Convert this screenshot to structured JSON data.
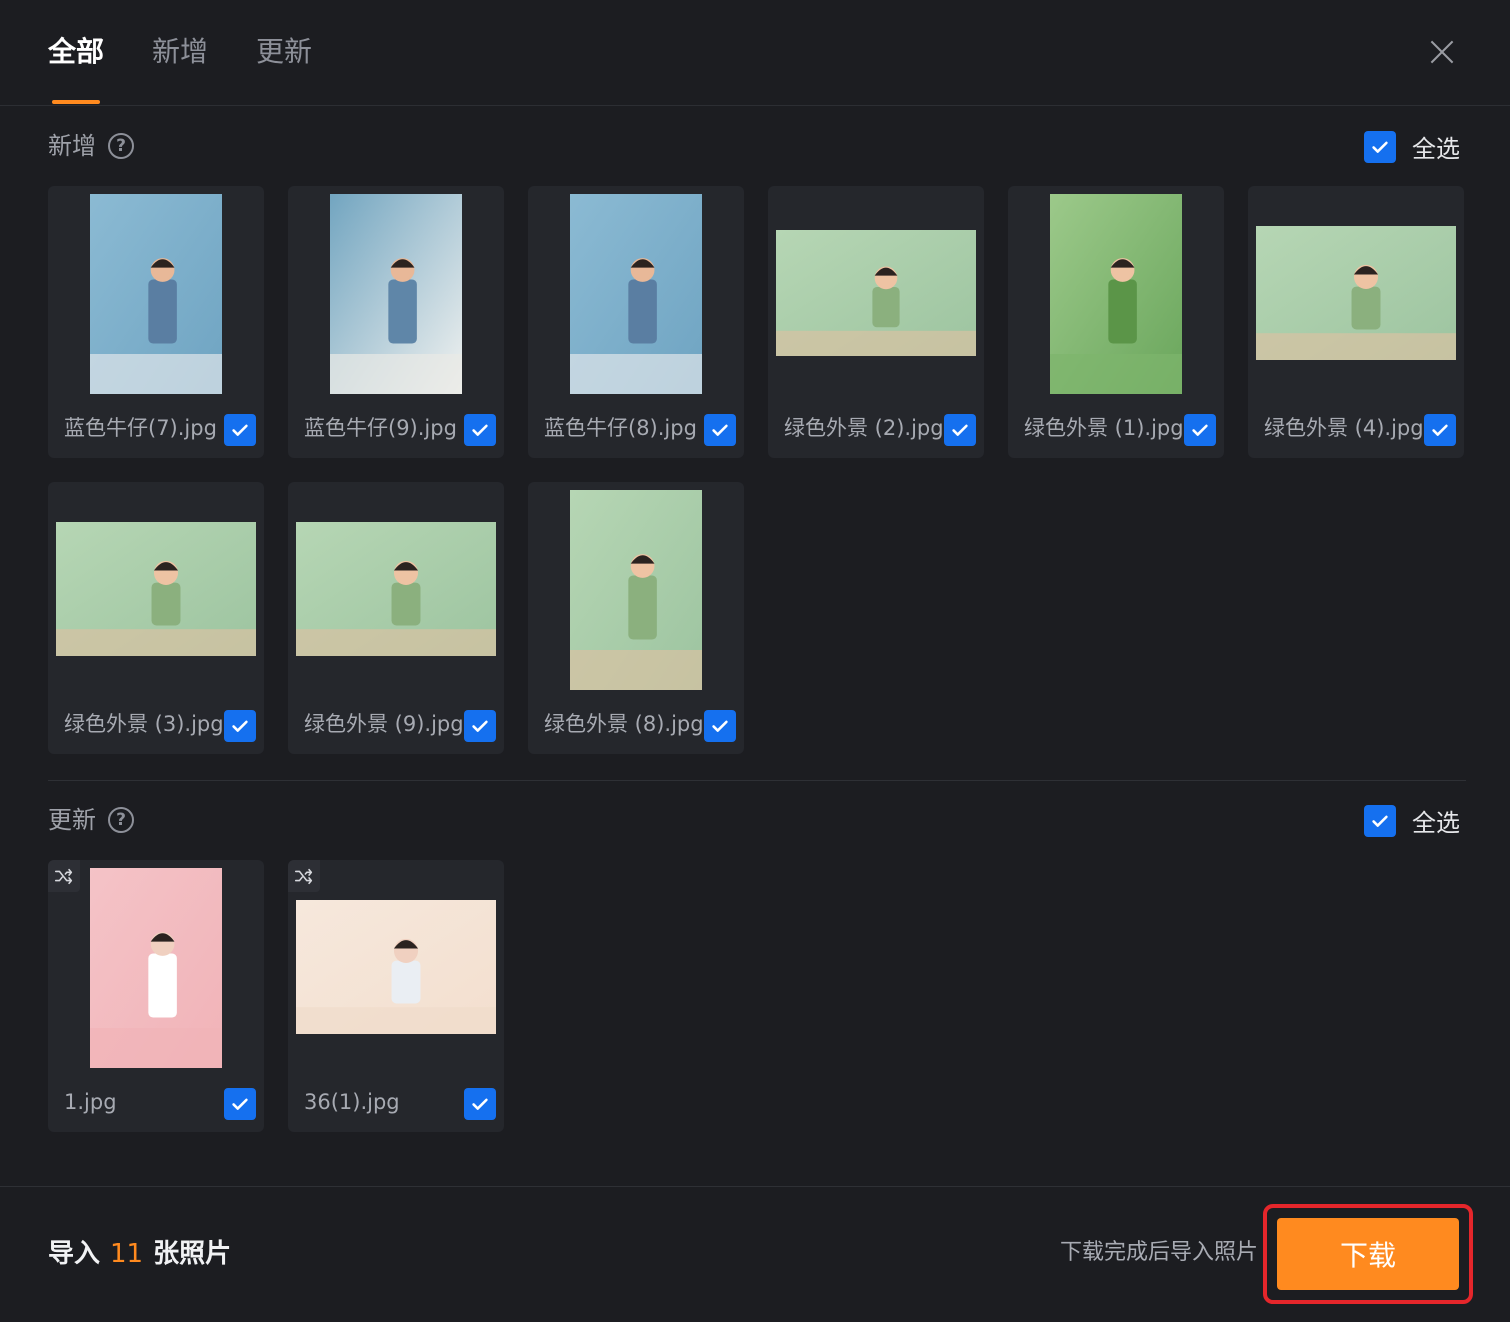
{
  "tabs": [
    {
      "label": "全部",
      "active": true
    },
    {
      "label": "新增",
      "active": false
    },
    {
      "label": "更新",
      "active": false
    }
  ],
  "sections": {
    "new": {
      "title": "新增",
      "select_all_label": "全选",
      "select_all_checked": true
    },
    "updated": {
      "title": "更新",
      "select_all_label": "全选",
      "select_all_checked": true
    }
  },
  "new_photos": [
    {
      "name": "蓝色牛仔(7).jpg",
      "checked": true,
      "theme": "blue"
    },
    {
      "name": "蓝色牛仔(9).jpg",
      "checked": true,
      "theme": "blue-light"
    },
    {
      "name": "蓝色牛仔(8).jpg",
      "checked": true,
      "theme": "blue"
    },
    {
      "name": "绿色外景 (2).jpg",
      "checked": true,
      "theme": "green"
    },
    {
      "name": "绿色外景 (1).jpg",
      "checked": true,
      "theme": "green-dark"
    },
    {
      "name": "绿色外景 (4).jpg",
      "checked": true,
      "theme": "green"
    },
    {
      "name": "绿色外景 (3).jpg",
      "checked": true,
      "theme": "green"
    },
    {
      "name": "绿色外景 (9).jpg",
      "checked": true,
      "theme": "green"
    },
    {
      "name": "绿色外景 (8).jpg",
      "checked": true,
      "theme": "green"
    }
  ],
  "updated_photos": [
    {
      "name": "1.jpg",
      "checked": true,
      "theme": "pink"
    },
    {
      "name": "36(1).jpg",
      "checked": true,
      "theme": "cream"
    }
  ],
  "footer": {
    "import_prefix": "导入",
    "import_count": "11",
    "import_suffix": "张照片",
    "hint": "下载完成后导入照片",
    "download_label": "下载"
  },
  "colors": {
    "accent": "#ff8a1f",
    "checkbox": "#1570ef",
    "highlight_box": "#e5262b"
  }
}
